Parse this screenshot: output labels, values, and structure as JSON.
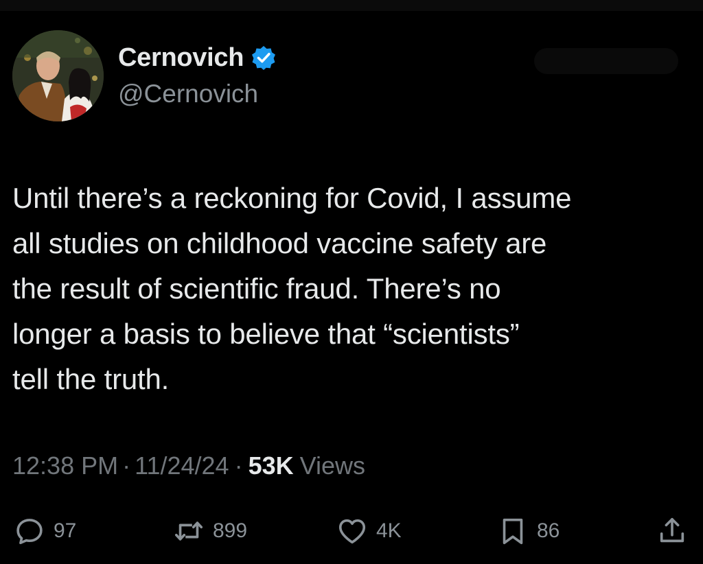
{
  "author": {
    "name": "Cernovich",
    "handle": "@Cernovich",
    "verified": true
  },
  "tweet": {
    "lines": [
      "Until there’s a reckoning for Covid, I assume",
      "all studies on childhood vaccine safety are",
      "the result of scientific fraud. There’s no",
      "longer a basis to believe that “scientists”",
      "tell the truth."
    ]
  },
  "meta": {
    "time": "12:38 PM",
    "separator": "·",
    "date": "11/24/24",
    "views_count": "53K",
    "views_label": "Views"
  },
  "actions": {
    "replies": "97",
    "reposts": "899",
    "likes": "4K",
    "bookmarks": "86"
  },
  "colors": {
    "background": "#000000",
    "text": "#e7e9ea",
    "secondary": "#71767b",
    "verified": "#1d9bf0"
  },
  "icons": [
    "verified-badge-icon",
    "reply-icon",
    "repost-icon",
    "like-icon",
    "bookmark-icon",
    "share-icon"
  ]
}
